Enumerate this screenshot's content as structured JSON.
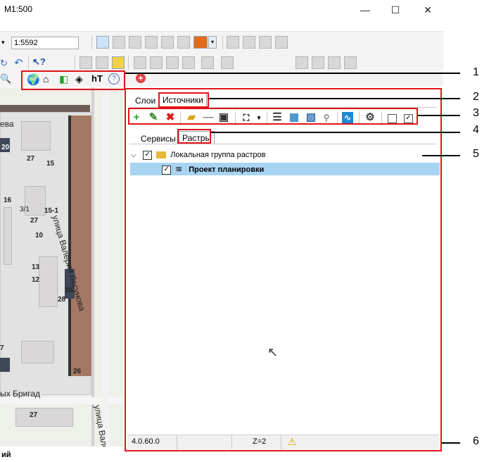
{
  "window": {
    "title": "M1:500",
    "minimize_glyph": "—",
    "maximize_glyph": "☐",
    "close_glyph": "✕"
  },
  "toolbar": {
    "scale_value": "1:5592"
  },
  "map": {
    "street_top": "ева",
    "street_vertical": "улица Валерия Лесунова",
    "street_bottom": "ых Бригад",
    "street_bottom_right": "улица Вале",
    "status_text": "ий",
    "numbers": [
      "20",
      "27",
      "15",
      "16",
      "3/1",
      "15-1",
      "27",
      "10",
      "13",
      "12",
      "30",
      "28",
      "7",
      "26",
      "27"
    ],
    "colors": {
      "land": "#eef0ea",
      "block": "#e2e2e2",
      "dark_building": "#3f4656",
      "road_brown": "#a57865"
    }
  },
  "panel": {
    "top_tabs": [
      {
        "label": "Слои",
        "active": false
      },
      {
        "label": "Источники",
        "active": true
      }
    ],
    "sub_tabs": [
      {
        "label": "Сервисы",
        "active": false
      },
      {
        "label": "Растры",
        "active": true
      }
    ],
    "tree": [
      {
        "label": "Локальная группа растров",
        "checked": true,
        "expanded": true,
        "level": 0
      },
      {
        "label": "Проект планировки",
        "checked": true,
        "selected": true,
        "bold": true,
        "level": 1
      }
    ],
    "status": {
      "version": "4.0.60.0",
      "zoom": "Z=2",
      "warning_icon": "warning-icon"
    }
  },
  "callouts": [
    "1",
    "2",
    "3",
    "4",
    "5",
    "6"
  ],
  "colors": {
    "highlight_red": "#e3141b",
    "selection_blue": "#a8d4f2",
    "accent_green": "#2e9e2e",
    "accent_red": "#d42020"
  }
}
